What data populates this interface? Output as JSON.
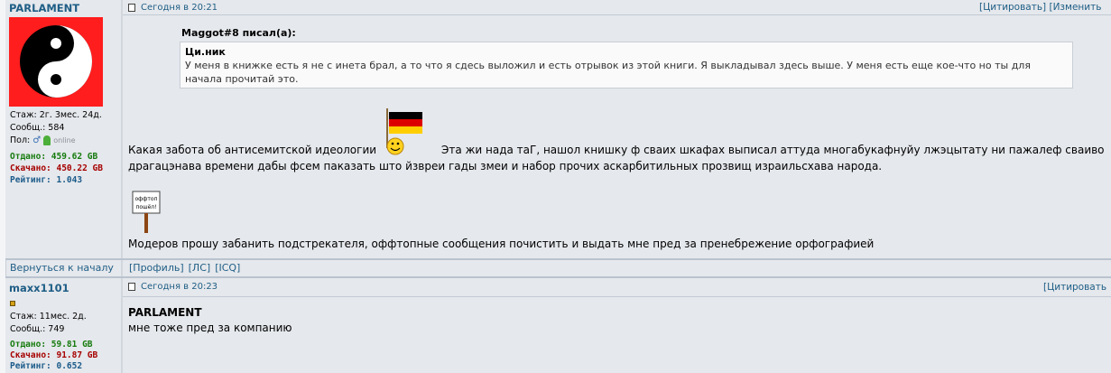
{
  "posts": [
    {
      "author": "PARLAMENT",
      "stats": {
        "tenure": "Стаж: 2г. 3мес. 24д.",
        "messages": "Сообщ.: 584",
        "gender_label": "Пол:",
        "online_label": "online",
        "uploaded": "Отдано: 459.62 GB",
        "downloaded": "Скачано: 450.22 GB",
        "rating": "Рейтинг: 1.043"
      },
      "time": "Сегодня в 20:21",
      "actions": [
        "[Цитировать]",
        "[Изменить"
      ],
      "quote_author": "Maggot#8 писал(а):",
      "quote_title": "Ци.ник",
      "quote_text": "У меня в книжке есть я не с инета брал, а то что я сдесь выложил и есть отрывок из этой книги. Я выкладывал здесь выше. У меня есть еще кое-что но ты для начала прочитай это.",
      "text_before": "Какая забота об антисемитской идеологии",
      "text_after": "Эта жи нада таГ, нашол книшку ф сваих шкафах выписал аттуда многабукафнуйу лжэцытату ни пажалеф сваиво драгацэнава времени дабы фсем паказать што йзвреи гады змеи и набор прочих аскарбитильных прозвищ израильсхава народа.",
      "sign_text": "оффтоп\nпошёл!",
      "text_last": "Модеров прошу забанить подстрекателя, оффтопные сообщения почистить и выдать мне пред за пренебрежение орфографией",
      "back_link": "Вернуться к началу",
      "profile_links": [
        "[Профиль]",
        "[ЛС]",
        "[ICQ]"
      ]
    },
    {
      "author": "maxx1101",
      "stats": {
        "tenure": "Стаж: 11мес. 2д.",
        "messages": "Сообщ.: 749",
        "uploaded": "Отдано: 59.81 GB",
        "downloaded": "Скачано: 91.87 GB",
        "rating": "Рейтинг: 0.652"
      },
      "time": "Сегодня в 20:23",
      "actions": [
        "[Цитировать"
      ],
      "addressee": "PARLAMENT",
      "text": "мне тоже пред за компанию"
    }
  ],
  "colors": {
    "link": "#1f5e86",
    "uploaded": "#157a0d",
    "downloaded": "#a60000",
    "rating": "#1a5a8a",
    "avatar_bg": "#ff1d1d"
  },
  "icons": [
    "yin-yang-avatar",
    "german-flag-smiley",
    "offtopic-sign",
    "post-icon",
    "male-user-icon",
    "rank-icon"
  ]
}
